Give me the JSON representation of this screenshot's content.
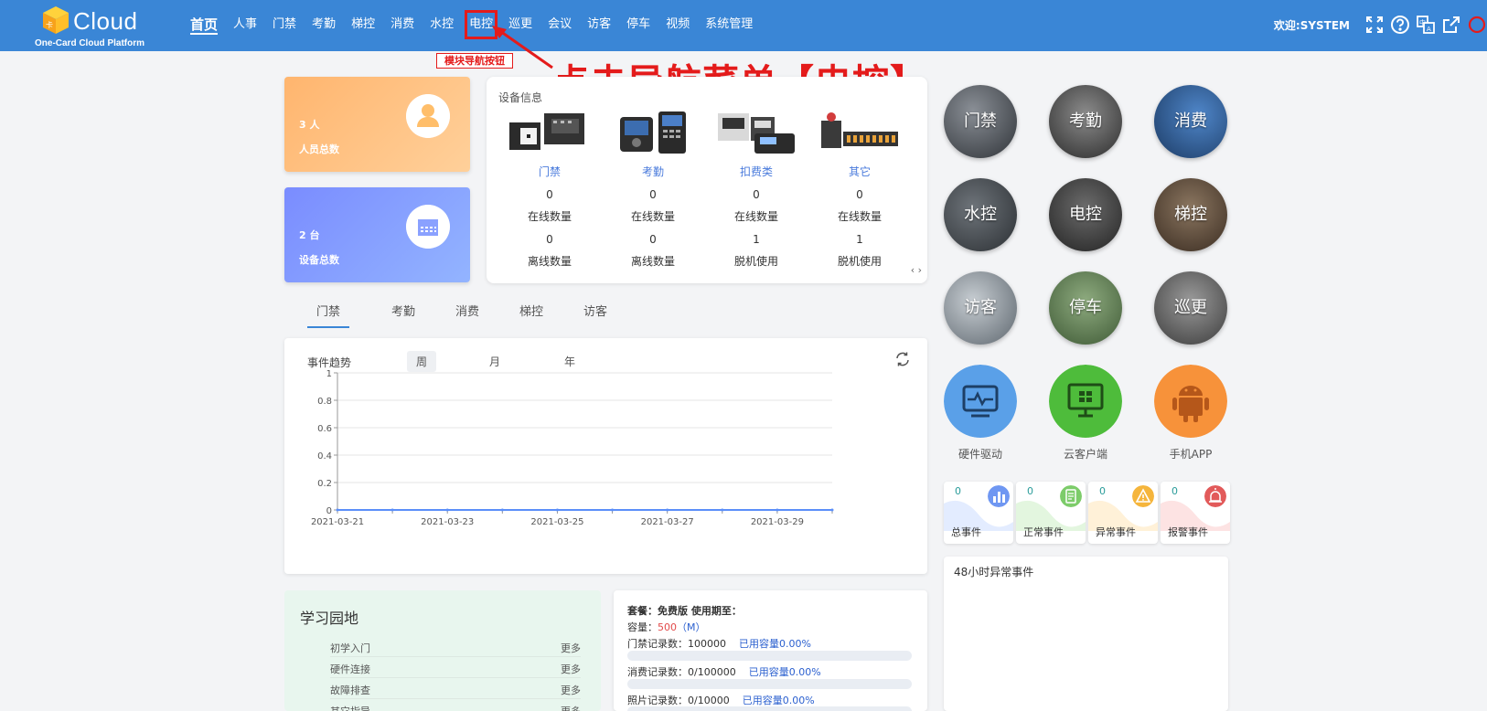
{
  "header": {
    "logo_text": "Cloud",
    "logo_sub": "One-Card Cloud Platform",
    "nav": [
      "首页",
      "人事",
      "门禁",
      "考勤",
      "梯控",
      "消费",
      "水控",
      "电控",
      "巡更",
      "会议",
      "访客",
      "停车",
      "视频",
      "系统管理"
    ],
    "welcome": "欢迎:SYSTEM"
  },
  "annotation": {
    "label": "模块导航按钮",
    "big": "点击导航菜单【电控】",
    "color": "#e41b1b"
  },
  "stats": {
    "people": {
      "value": "3 人",
      "label": "人员总数"
    },
    "devices": {
      "value": "2 台",
      "label": "设备总数"
    }
  },
  "device_info": {
    "title": "设备信息",
    "columns": [
      {
        "name": "门禁",
        "v1": "0",
        "l1": "在线数量",
        "v2": "0",
        "l2": "离线数量"
      },
      {
        "name": "考勤",
        "v1": "0",
        "l1": "在线数量",
        "v2": "0",
        "l2": "离线数量"
      },
      {
        "name": "扣费类",
        "v1": "0",
        "l1": "在线数量",
        "v2": "1",
        "l2": "脱机使用"
      },
      {
        "name": "其它",
        "v1": "0",
        "l1": "在线数量",
        "v2": "1",
        "l2": "脱机使用"
      }
    ]
  },
  "tabs": [
    "门禁",
    "考勤",
    "消费",
    "梯控",
    "访客"
  ],
  "event_chart": {
    "title": "事件趋势",
    "periods": [
      "周",
      "月",
      "年"
    ]
  },
  "chart_data": {
    "type": "line",
    "title": "事件趋势",
    "x": [
      "2021-03-21",
      "2021-03-22",
      "2021-03-23",
      "2021-03-24",
      "2021-03-25",
      "2021-03-26",
      "2021-03-27",
      "2021-03-28",
      "2021-03-29",
      "2021-03-30"
    ],
    "x_tick_labels": [
      "2021-03-21",
      "2021-03-23",
      "2021-03-25",
      "2021-03-27",
      "2021-03-29"
    ],
    "series": [
      {
        "values": [
          0,
          0,
          0,
          0,
          0,
          0,
          0,
          0,
          0,
          0
        ]
      }
    ],
    "ylim": [
      0,
      1
    ],
    "y_ticks": [
      "0",
      "0.2",
      "0.4",
      "0.6",
      "0.8",
      "1"
    ],
    "grid": true,
    "color": "#5b8ff9"
  },
  "study": {
    "title": "学习园地",
    "more": "更多",
    "items": [
      "初学入门",
      "硬件连接",
      "故障排查",
      "其它指导"
    ]
  },
  "plan": {
    "package": "套餐：免费版 使用期至：",
    "capacity_prefix": "容量：",
    "capacity_value": "500",
    "capacity_unit": "（M）",
    "rows": [
      {
        "label": "门禁记录数：100000",
        "used": "已用容量0.00%",
        "fill": 0.0
      },
      {
        "label": "消费记录数：0/100000",
        "used": "已用容量0.00%",
        "fill": 0.0
      },
      {
        "label": "照片记录数：0/10000",
        "used": "已用容量0.00%",
        "fill": 0.0
      }
    ]
  },
  "modules": [
    "门禁",
    "考勤",
    "消费",
    "水控",
    "电控",
    "梯控",
    "访客",
    "停车",
    "巡更"
  ],
  "apps": [
    "硬件驱动",
    "云客户端",
    "手机APP"
  ],
  "event_stats": [
    {
      "num": "0",
      "label": "总事件",
      "color": "#5b8ff9"
    },
    {
      "num": "0",
      "label": "正常事件",
      "color": "#6cc66c"
    },
    {
      "num": "0",
      "label": "异常事件",
      "color": "#f5b53c"
    },
    {
      "num": "0",
      "label": "报警事件",
      "color": "#e25a5a"
    }
  ],
  "abnormal": {
    "title": "48小时异常事件"
  }
}
